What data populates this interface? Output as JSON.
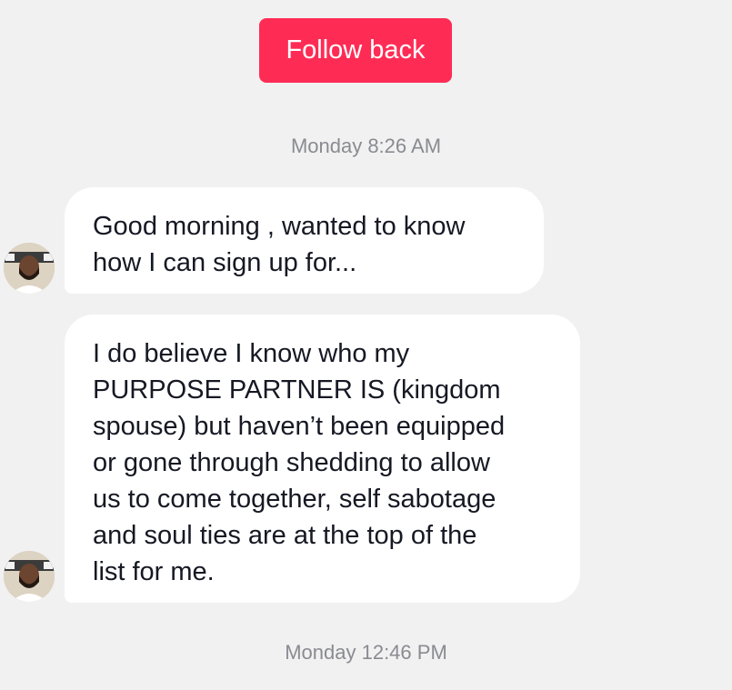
{
  "header": {
    "follow_back_label": "Follow back"
  },
  "messages": {
    "timestamp_1": "Monday 8:26 AM",
    "message_1_line_1": "Good morning , wanted to know",
    "message_1_line_2": "how I can sign up for...",
    "message_2_lines": [
      "I do believe I know who my",
      "PURPOSE PARTNER IS (kingdom",
      "spouse) but haven’t been equipped",
      "or gone through shedding to allow",
      "us to come together, self sabotage",
      "and soul ties are at the top of the",
      "list for me."
    ],
    "timestamp_2": "Monday 12:46 PM"
  },
  "colors": {
    "background": "#f1f1f2",
    "follow_button": "#fe2c55",
    "bubble": "#ffffff",
    "text": "#161823",
    "timestamp": "#8a8b91"
  },
  "icons": {
    "avatar": "user-avatar-photo"
  }
}
